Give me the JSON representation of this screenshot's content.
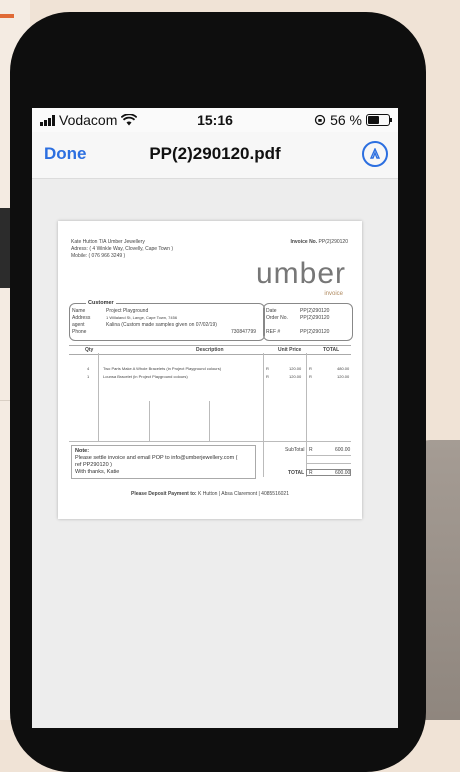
{
  "status_bar": {
    "carrier": "Vodacom",
    "time": "15:16",
    "battery": "56 %"
  },
  "nav": {
    "done_label": "Done",
    "title": "PP(2)290120.pdf"
  },
  "invoice": {
    "sender_line1": "Kate Hutton T/A Umber Jewellery",
    "sender_line2": "Adress: ( 4 Winkle Way, Clovelly, Cape Town )",
    "sender_line3": "Mobile: ( 076 966 3249 )",
    "invoice_no_label": "Invoice No.",
    "invoice_no_value": "PP(2)290120",
    "logo_text": "umber",
    "logo_sub": "invoice",
    "customer": {
      "heading": "Customer",
      "name_label": "Name",
      "name_value": "Project Playground",
      "address_label": "Address",
      "address_value": "1 Willaland St, Lange, Cape Town, 7456",
      "agent_label": "agent",
      "agent_value": "Kalina (Custom made samples given on 07/02/19)",
      "phone_label": "Phone",
      "phone_value": "730847799"
    },
    "meta": {
      "date_label": "Date",
      "date_value": "PP(2)290120",
      "order_label": "Order No.",
      "order_value": "PP(2)290120",
      "ref_label": "REF #",
      "ref_value": "PP(2)290120"
    },
    "table": {
      "headers": [
        "Qty",
        "Description",
        "Unit Price",
        "TOTAL"
      ],
      "rows": [
        {
          "qty": "4",
          "desc": "Two Parts Make A Whole Bracelets (in Project Playground colours)",
          "cur1": "R",
          "unit": "120.00",
          "cur2": "R",
          "total": "480.00"
        },
        {
          "qty": "1",
          "desc": "Lounsa Bracelet (in Project Playground colours)",
          "cur1": "R",
          "unit": "120.00",
          "cur2": "R",
          "total": "120.00"
        }
      ],
      "subtotal_label": "SubTotal",
      "subtotal_cur": "R",
      "subtotal_value": "600.00",
      "total_label": "TOTAL",
      "total_cur": "R",
      "total_value": "600.00"
    },
    "note": {
      "heading": "Note:",
      "line1": "Please settle invoice and email POP to info@umberjewellery.com (",
      "line2": "ref PP290120 )",
      "line3": "With thanks, Katie"
    },
    "footer_bold": "Please Deposit Payment to:",
    "footer_rest": "K Hutton | Absa Claremont | 4085516021"
  }
}
